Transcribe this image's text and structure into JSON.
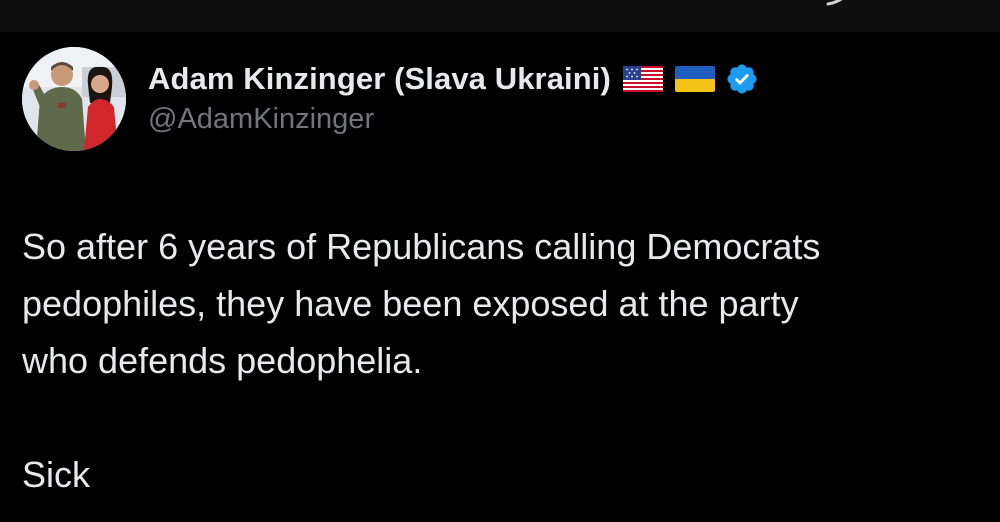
{
  "tweet": {
    "author": {
      "display_name": "Adam Kinzinger (Slava Ukraini)",
      "handle": "@AdamKinzinger",
      "flags": [
        "us-flag-icon",
        "ukraine-flag-icon"
      ],
      "verified": true
    },
    "text": "So after 6 years of Republicans calling Democrats\npedophiles, they have been exposed at the party\nwho defends pedophelia.\n\nSick"
  },
  "colors": {
    "background": "#000000",
    "text_primary": "#e7e9ea",
    "text_secondary": "#71767b",
    "verified_blue": "#1d9bf0"
  }
}
